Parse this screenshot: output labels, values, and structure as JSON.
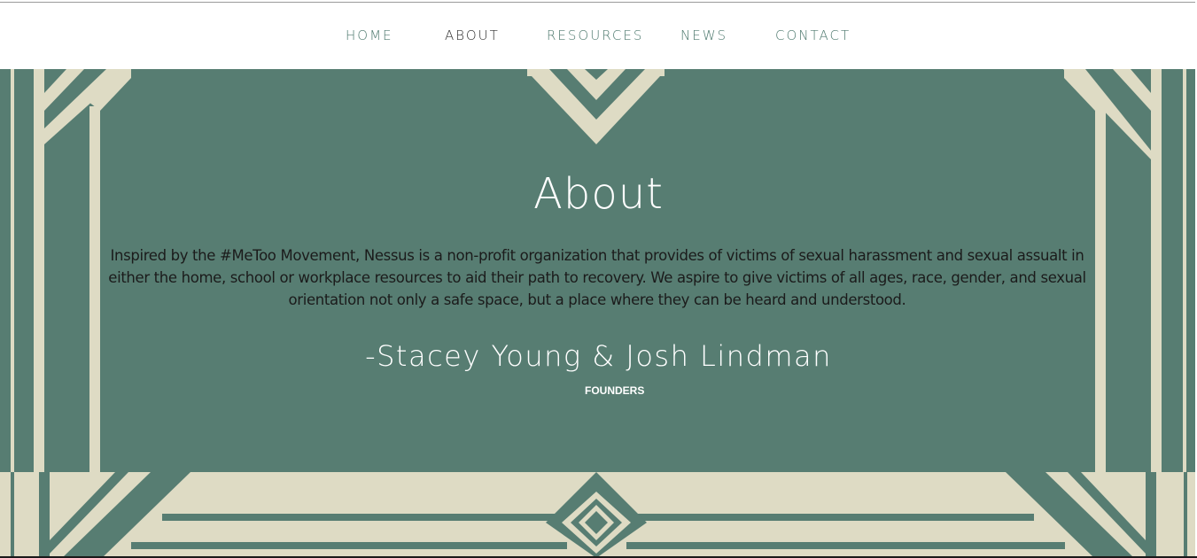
{
  "nav": {
    "items": [
      {
        "label": "HOME"
      },
      {
        "label": "ABOUT"
      },
      {
        "label": "RESOURCES"
      },
      {
        "label": "NEWS"
      },
      {
        "label": "CONTACT"
      }
    ],
    "active": "ABOUT"
  },
  "about": {
    "title": "About",
    "body": "Inspired by the #MeToo Movement, Nessus is a non-profit organization that provides of victims of sexual harassment and sexual assualt in either the home, school or workplace resources to aid their path to recovery. We aspire to give victims of all ages, race, gender, and sexual orientation not only a safe space, but a place where they can be heard and understood.",
    "signature": "-Stacey Young & Josh Lindman",
    "role": "FOUNDERS"
  },
  "colors": {
    "teal": "#577d72",
    "cream": "#dedbc4",
    "nav_text": "#4f7a6f",
    "nav_active": "#2f2f2f"
  }
}
